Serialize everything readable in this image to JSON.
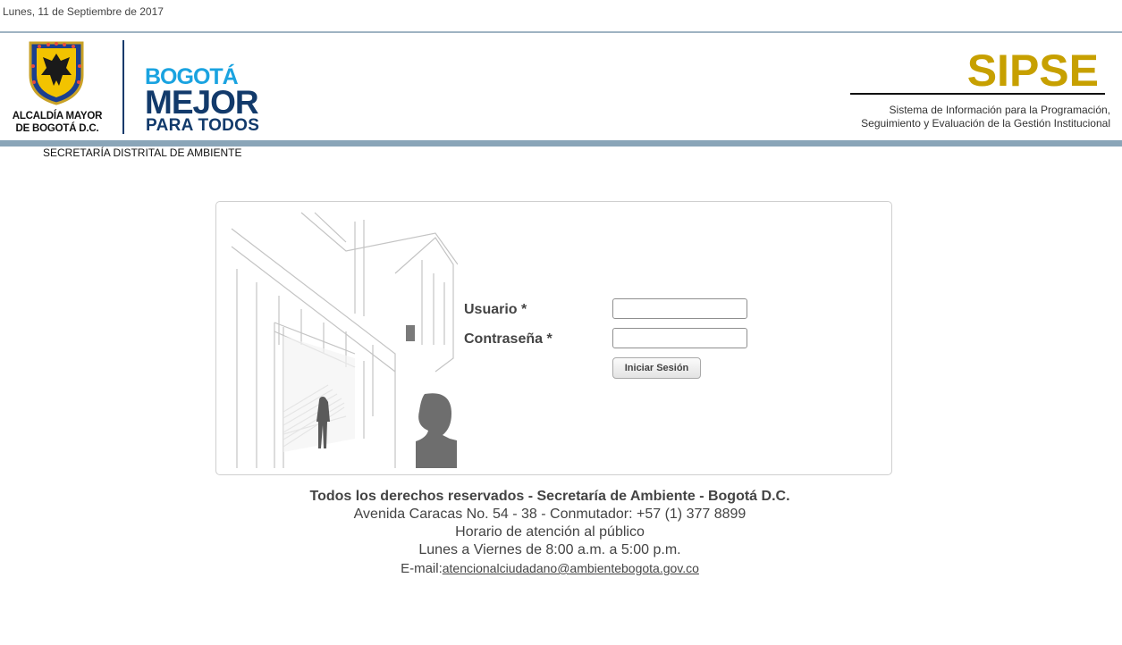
{
  "header": {
    "date": "Lunes, 11 de Septiembre de 2017",
    "alcaldia_line1": "ALCALDÍA MAYOR",
    "alcaldia_line2": "DE BOGOTÁ D.C.",
    "bogota_line1": "BOGOTÁ",
    "bogota_line2": "MEJOR",
    "bogota_line3": "PARA TODOS",
    "secretaria": "SECRETARÍA DISTRITAL DE AMBIENTE",
    "app_name": "SIPSE",
    "app_sub_line1": "Sistema de Información para la Programación,",
    "app_sub_line2": "Seguimiento y Evaluación de la Gestión Institucional"
  },
  "login": {
    "user_label": "Usuario *",
    "user_value": "",
    "pass_label": "Contraseña *",
    "pass_value": "",
    "submit_label": "Iniciar Sesión"
  },
  "footer": {
    "rights": "Todos los derechos reservados - Secretaría de Ambiente - Bogotá D.C.",
    "address": "Avenida Caracas No. 54 - 38 - Conmutador: +57 (1) 377 8899",
    "hours_title": "Horario de atención al público",
    "hours": "Lunes a Viernes de 8:00 a.m. a 5:00 p.m.",
    "email_label": "E-mail:",
    "email": "atencionalciudadano@ambientebogota.gov.co"
  },
  "colors": {
    "brand_gold": "#c7a000",
    "brand_blue_dark": "#123a6b",
    "brand_blue_light": "#1aa3e0",
    "band": "#8aa5b8"
  },
  "icons": [
    "coat-of-arms-logo",
    "building-illustration"
  ]
}
